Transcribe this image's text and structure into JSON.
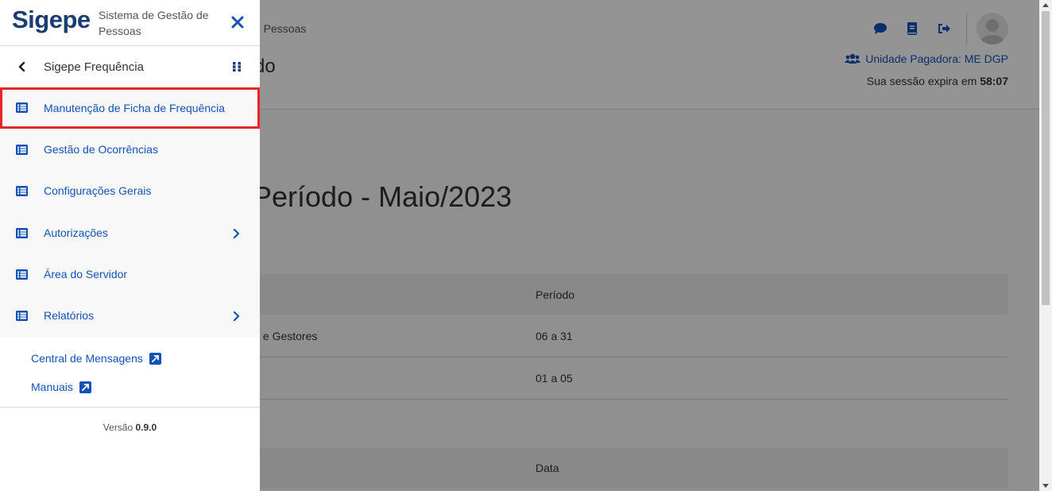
{
  "background": {
    "breadcrumb": "e Pessoas",
    "page_title_fragment": "do",
    "unit_label": "Unidade Pagadora: ME DGP",
    "session_text": "Sua sessão expira em",
    "session_time": "58:07",
    "period_heading": "Período - Maio/2023",
    "table1": {
      "header_col2": "Período",
      "rows": [
        {
          "col1": "s e Gestores",
          "col2": "06 a 31"
        },
        {
          "col1": "",
          "col2": "01 a 05"
        }
      ]
    },
    "table2": {
      "header_col2": "Data"
    },
    "icons": [
      "chat-icon",
      "book-icon",
      "logout-icon",
      "user-avatar-icon",
      "users-icon"
    ]
  },
  "sidebar": {
    "logo": "Sigepe",
    "system_name": "Sistema de Gestão de Pessoas",
    "submenu_title": "Sigepe Frequência",
    "items": [
      {
        "label": "Manutenção de Ficha de Frequência",
        "has_children": false,
        "active": true
      },
      {
        "label": "Gestão de Ocorrências",
        "has_children": false,
        "active": false
      },
      {
        "label": "Configurações Gerais",
        "has_children": false,
        "active": false
      },
      {
        "label": "Autorizações",
        "has_children": true,
        "active": false
      },
      {
        "label": "Área do Servidor",
        "has_children": false,
        "active": false
      },
      {
        "label": "Relatórios",
        "has_children": true,
        "active": false
      }
    ],
    "links": [
      {
        "label": "Central de Mensagens"
      },
      {
        "label": "Manuais"
      }
    ],
    "version_label": "Versão",
    "version_number": "0.9.0"
  },
  "colors": {
    "brand": "#1a3e74",
    "link": "#1351b4",
    "active_border": "#e5262b"
  }
}
